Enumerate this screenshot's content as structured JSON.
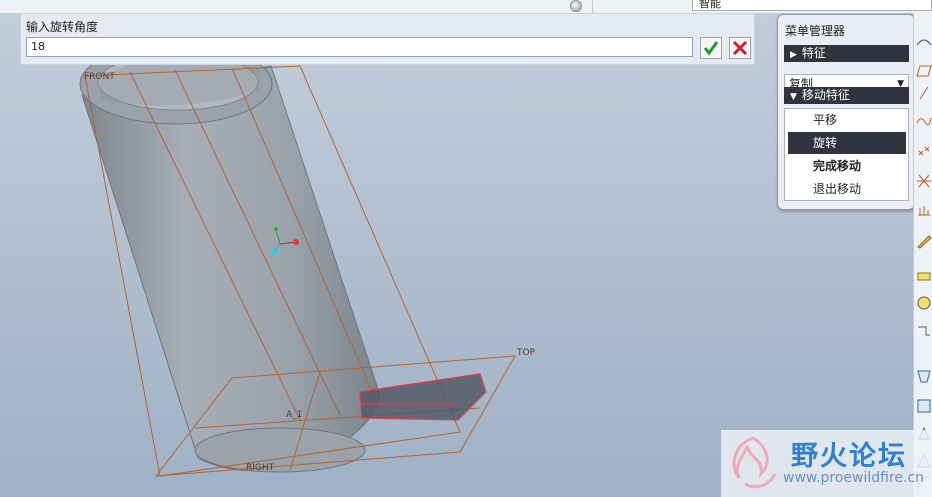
{
  "topbar": {
    "right_field_value": "智能"
  },
  "input_bar": {
    "prompt_label": "输入旋转角度",
    "angle_value": "18",
    "ok_icon": "green-check-icon",
    "cancel_icon": "red-x-icon"
  },
  "menu_manager": {
    "title": "菜单管理器",
    "section_feature": "特征",
    "dropdown_value": "复制",
    "section_move": "移动特征",
    "items": [
      {
        "label": "平移",
        "selected": false,
        "bold": false
      },
      {
        "label": "旋转",
        "selected": true,
        "bold": false
      },
      {
        "label": "完成移动",
        "selected": false,
        "bold": true
      },
      {
        "label": "退出移动",
        "selected": false,
        "bold": false
      }
    ]
  },
  "viewport": {
    "datum_labels": {
      "front": "FRONT",
      "top": "TOP",
      "right": "RIGHT",
      "axis": "A_1"
    }
  },
  "watermark": {
    "brand_cn": "野火论坛",
    "url": "www.proewildfire.cn"
  },
  "colors": {
    "datum_plane": "#b5652c",
    "selection_red": "#e23a4a",
    "menu_header": "#2f3540",
    "brand_blue": "#2f7fd3"
  }
}
